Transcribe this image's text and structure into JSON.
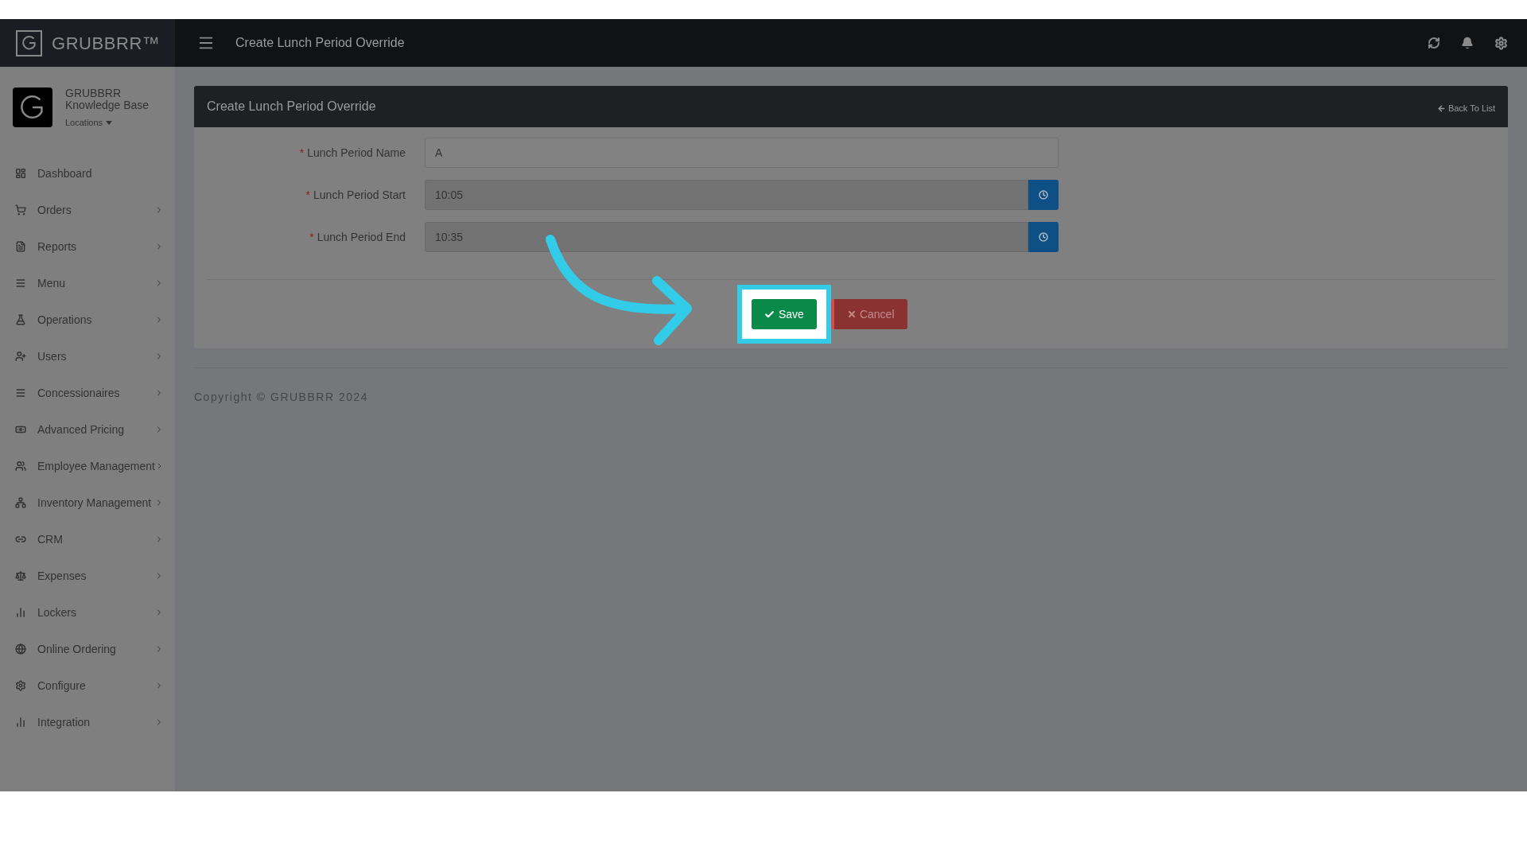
{
  "brand": {
    "name": "GRUBBRR™"
  },
  "profile": {
    "title": "GRUBBRR Knowledge Base",
    "menu": "Locations"
  },
  "sidebar": {
    "items": [
      {
        "label": "Dashboard",
        "has_submenu": false
      },
      {
        "label": "Orders",
        "has_submenu": true
      },
      {
        "label": "Reports",
        "has_submenu": true
      },
      {
        "label": "Menu",
        "has_submenu": true
      },
      {
        "label": "Operations",
        "has_submenu": true
      },
      {
        "label": "Users",
        "has_submenu": true
      },
      {
        "label": "Concessionaires",
        "has_submenu": true
      },
      {
        "label": "Advanced Pricing",
        "has_submenu": true
      },
      {
        "label": "Employee Management",
        "has_submenu": true
      },
      {
        "label": "Inventory Management",
        "has_submenu": true
      },
      {
        "label": "CRM",
        "has_submenu": true
      },
      {
        "label": "Expenses",
        "has_submenu": true
      },
      {
        "label": "Lockers",
        "has_submenu": true
      },
      {
        "label": "Online Ordering",
        "has_submenu": true
      },
      {
        "label": "Configure",
        "has_submenu": true
      },
      {
        "label": "Integration",
        "has_submenu": true
      }
    ]
  },
  "header": {
    "title": "Create Lunch Period Override"
  },
  "card": {
    "title": "Create Lunch Period Override",
    "back_link": "Back To List",
    "fields": [
      {
        "kind": "text",
        "label": "Lunch Period Name",
        "required_mark": "*",
        "value": "A"
      },
      {
        "kind": "time",
        "label": "Lunch Period Start",
        "required_mark": "*",
        "value": "10:05"
      },
      {
        "kind": "time",
        "label": "Lunch Period End",
        "required_mark": "*",
        "value": "10:35"
      }
    ],
    "buttons": [
      {
        "kind": "save",
        "label": "Save",
        "highlighted": true
      },
      {
        "kind": "cancel",
        "label": "Cancel",
        "highlighted": false
      }
    ]
  },
  "footer": {
    "copyright": "Copyright © GRUBBRR 2024"
  }
}
